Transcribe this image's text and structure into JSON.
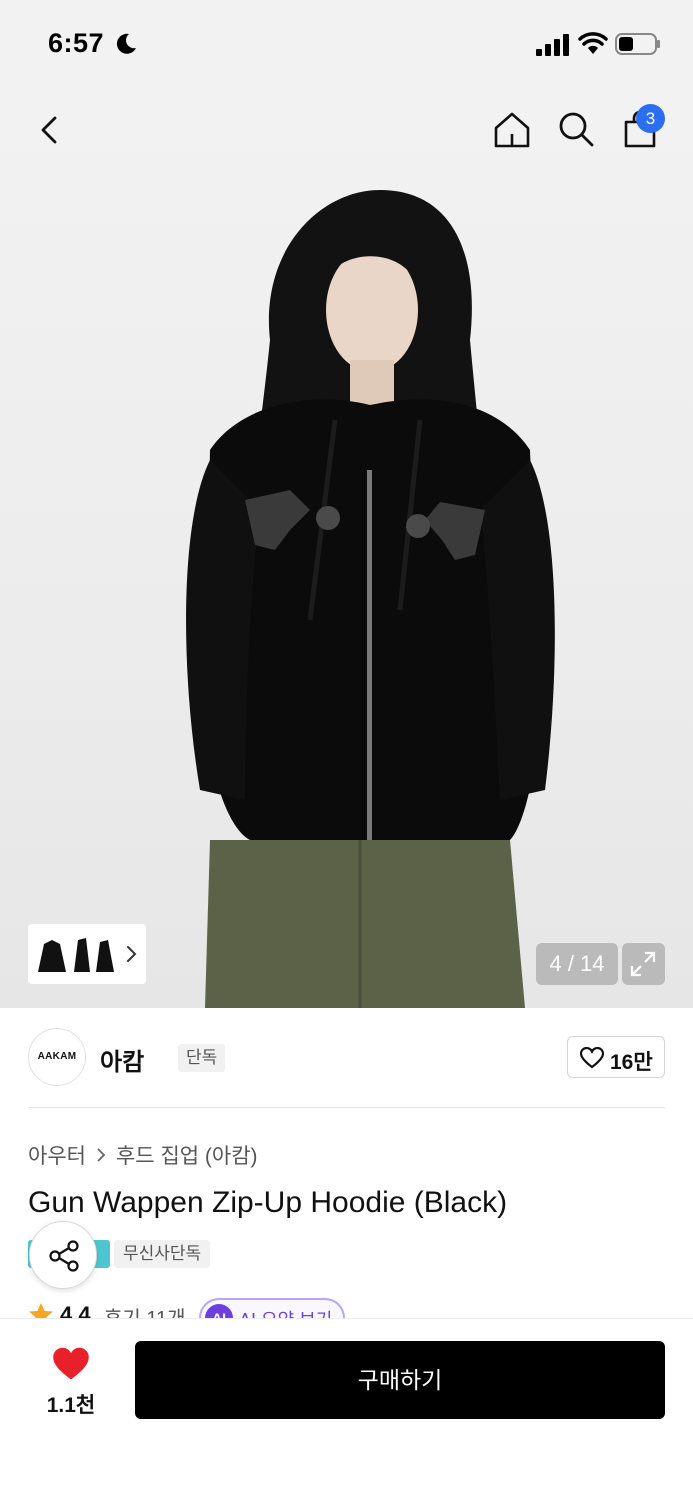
{
  "status_bar": {
    "time": "6:57"
  },
  "nav": {
    "cart_count": "3"
  },
  "gallery": {
    "page_indicator": "4 / 14"
  },
  "brand": {
    "logo_text": "AAKAM",
    "name": "아캄",
    "tag": "단독",
    "likes": "16만"
  },
  "product": {
    "breadcrumb": [
      "아우터",
      "후드 집업 (아캄)"
    ],
    "title": "Gun Wappen Zip-Up Hoodie (Black)",
    "badge_exclusive": "무신사단독",
    "rating": "4.4",
    "reviews": "후기 11개",
    "ai_badge": "AI",
    "ai_label": "AI 요약 보기"
  },
  "bottom_bar": {
    "like_count": "1.1천",
    "buy_label": "구매하기"
  },
  "colors": {
    "accent_blue": "#2a6ef2",
    "heart_red": "#e8202a",
    "ai_purple": "#6d3fe0",
    "badge_teal": "#4fc6cf",
    "star_orange": "#f5a623"
  },
  "icons": [
    "moon-icon",
    "signal-icon",
    "wifi-icon",
    "battery-icon",
    "back-icon",
    "home-icon",
    "search-icon",
    "cart-icon",
    "expand-icon",
    "chevron-right-icon",
    "heart-outline-icon",
    "share-icon",
    "star-icon",
    "heart-filled-icon"
  ]
}
